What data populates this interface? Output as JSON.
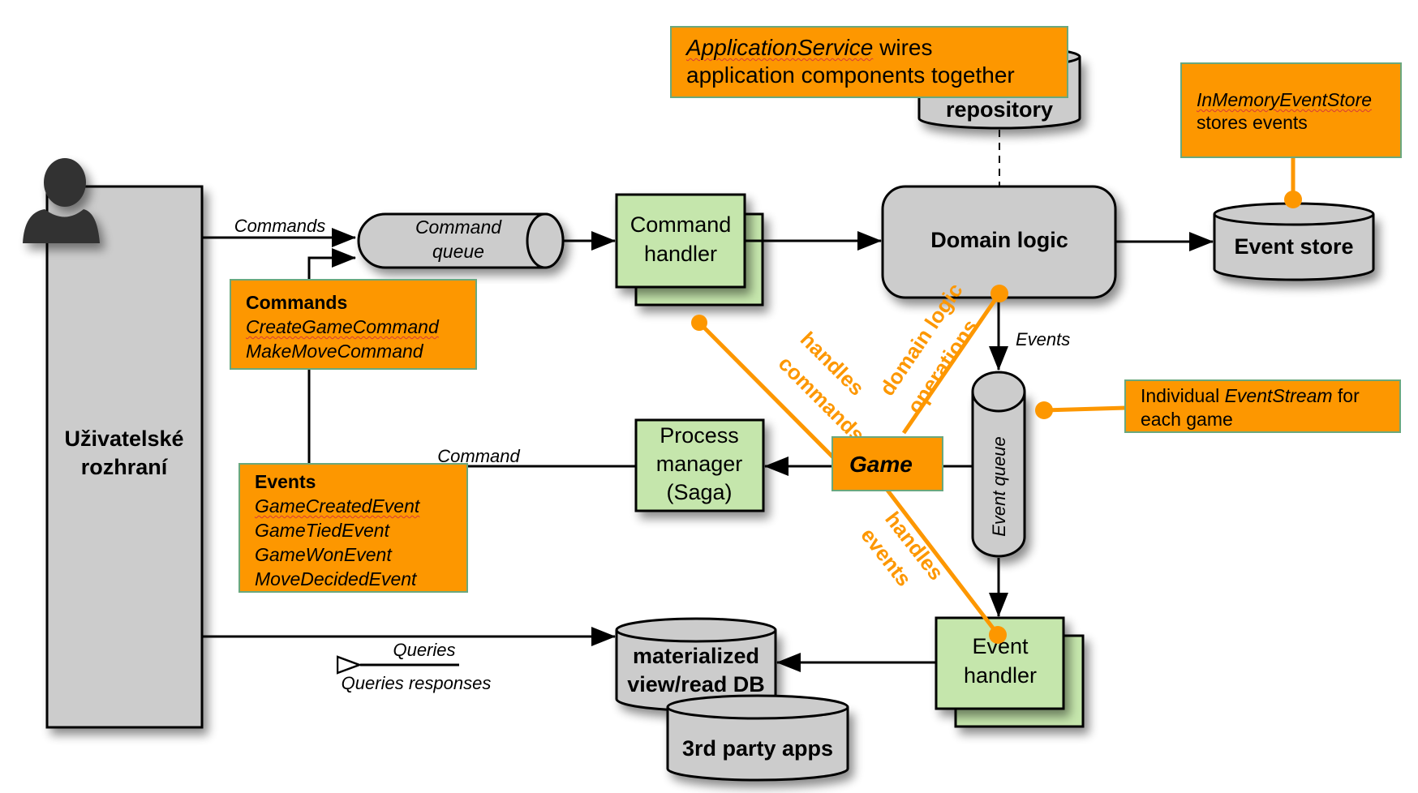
{
  "colors": {
    "note_fill": "#fd9700",
    "note_border": "#6aa87e",
    "component_fill": "#c5e6ac",
    "storage_fill": "#cccccc",
    "connector_orange": "#fd9700",
    "line": "#000000",
    "actor": "#333333"
  },
  "user_interface": {
    "label_line1": "Uživatelské",
    "label_line2": "rozhraní"
  },
  "command_queue": {
    "line1": "Command",
    "line2": "queue"
  },
  "command_handler": {
    "line1": "Command",
    "line2": "handler"
  },
  "domain_logic": {
    "label": "Domain logic"
  },
  "repository": {
    "label": "repository"
  },
  "event_store": {
    "label": "Event store"
  },
  "event_queue": {
    "label": "Event queue"
  },
  "process_manager": {
    "line1": "Process",
    "line2": "manager",
    "line3": "(Saga)"
  },
  "event_handler": {
    "line1": "Event",
    "line2": "handler"
  },
  "read_db": {
    "line1": "materialized",
    "line2": "view/read DB"
  },
  "third_party": {
    "label": "3rd party apps"
  },
  "edge_labels": {
    "commands": "Commands",
    "events": "Events",
    "command": "Command",
    "queries": "Queries",
    "queries_responses": "Queries responses"
  },
  "notes": {
    "application_service": {
      "italic": "ApplicationService",
      "rest1": " wires",
      "line2": "application components together"
    },
    "in_memory_event_store": {
      "italic": "InMemoryEventStore",
      "line2": "stores events"
    },
    "event_stream": {
      "prefix": "Individual ",
      "italic": "EventStream",
      "suffix": " for",
      "line2": "each game"
    },
    "commands_list": {
      "title": "Commands",
      "items": [
        "CreateGameCommand",
        "MakeMoveCommand"
      ]
    },
    "events_list": {
      "title": "Events",
      "items": [
        "GameCreatedEvent",
        "GameTiedEvent",
        "GameWonEvent",
        "MoveDecidedEvent"
      ]
    },
    "game": {
      "label": "Game"
    }
  },
  "connector_labels": {
    "handles_commands": [
      "handles",
      "commands"
    ],
    "domain_logic_operations": [
      "domain logic",
      "operations"
    ],
    "handles_events": [
      "handles",
      "events"
    ]
  }
}
